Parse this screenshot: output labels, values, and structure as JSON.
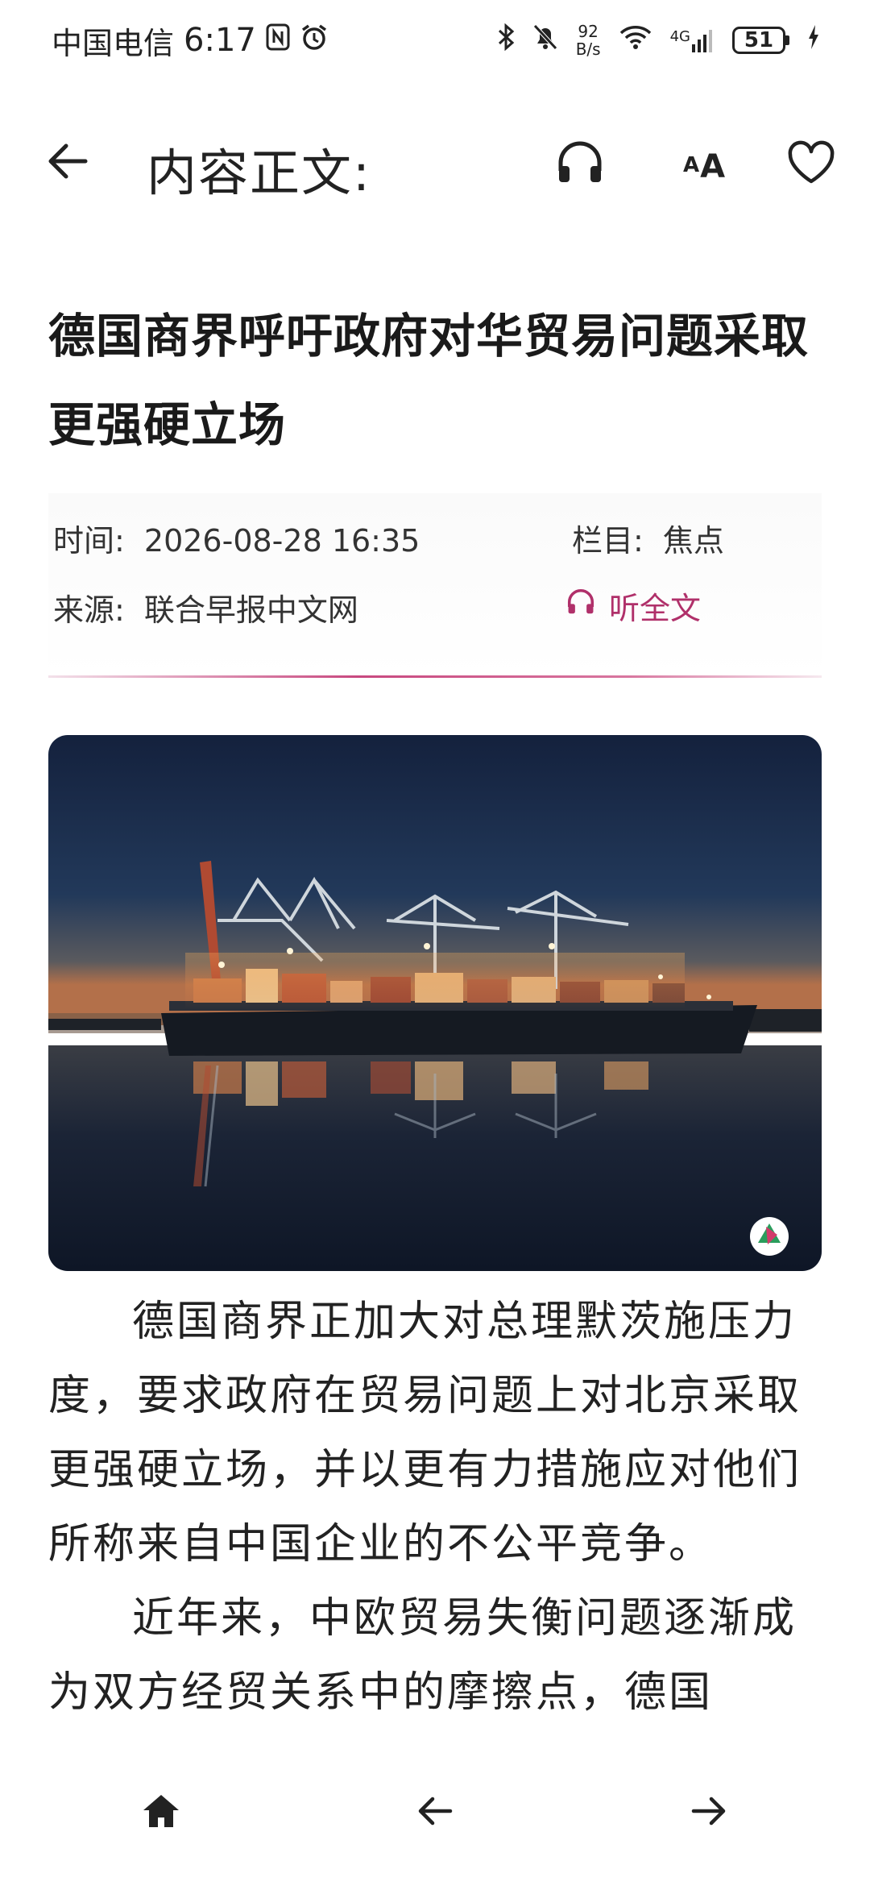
{
  "status_bar": {
    "carrier": "中国电信",
    "time": "6:17",
    "net_speed_value": "92",
    "net_speed_unit": "B/s",
    "network": "4G",
    "battery": "51"
  },
  "header": {
    "title": "内容正文:",
    "font_size_small": "A",
    "font_size_large": "A"
  },
  "article": {
    "title": "德国商界呼吁政府对华贸易问题采取更强硬立场",
    "time_label": "时间:",
    "time_value": "2026-08-28 16:35",
    "column_label": "栏目:",
    "column_value": "焦点",
    "source_label": "来源:",
    "source_value": "联合早报中文网",
    "listen_label": "听全文",
    "paragraphs": [
      "德国商界正加大对总理默茨施压力度，要求政府在贸易问题上对北京采取更强硬立场，并以更有力措施应对他们所称来自中国企业的不公平竞争。",
      "近年来，中欧贸易失衡问题逐渐成为双方经贸关系中的摩擦点，德国"
    ]
  },
  "colors": {
    "accent": "#b0306a",
    "text": "#222222"
  },
  "icons": {
    "back": "arrow-left-icon",
    "listen": "headphones-icon",
    "font_size": "font-size-icon",
    "favorite": "heart-icon",
    "home": "home-icon",
    "nav_back": "arrow-left-icon",
    "nav_forward": "arrow-right-icon"
  }
}
